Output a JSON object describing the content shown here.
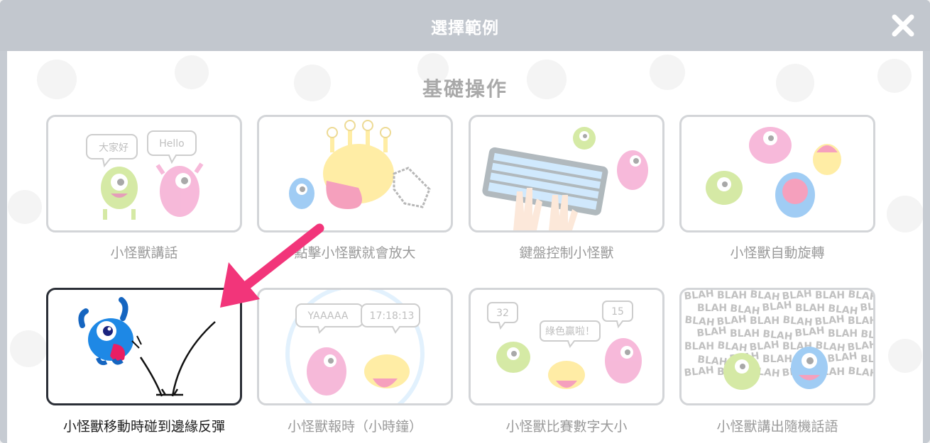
{
  "dialog": {
    "title": "選擇範例",
    "close_icon": "close-x-icon"
  },
  "section": {
    "title": "基礎操作"
  },
  "examples": [
    {
      "label": "小怪獸講話",
      "bubbles": [
        "大家好",
        "Hello"
      ],
      "selected": false
    },
    {
      "label": "點擊小怪獸就會放大",
      "selected": false
    },
    {
      "label": "鍵盤控制小怪獸",
      "selected": false
    },
    {
      "label": "小怪獸自動旋轉",
      "selected": false
    },
    {
      "label": "小怪獸移動時碰到邊緣反彈",
      "selected": true
    },
    {
      "label": "小怪獸報時（小時鐘）",
      "bubbles": [
        "YAAAAA",
        "17:18:13"
      ],
      "selected": false
    },
    {
      "label": "小怪獸比賽數字大小",
      "bubbles": [
        "32",
        "綠色贏啦！",
        "15"
      ],
      "selected": false
    },
    {
      "label": "小怪獸講出隨機話語",
      "blah": "BLAH",
      "selected": false
    }
  ],
  "colors": {
    "accent_arrow": "#f2357a",
    "title_bar": "#c2c7ce",
    "selected_border": "#2b2f37",
    "card_border": "#d3d5d8"
  }
}
